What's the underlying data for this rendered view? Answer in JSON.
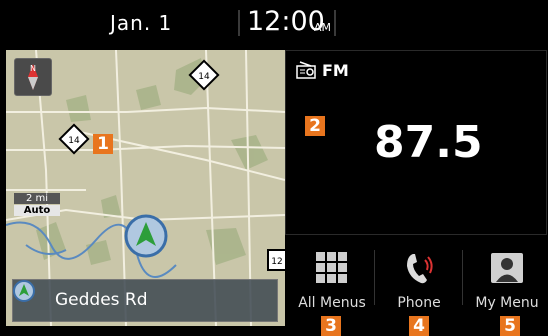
{
  "status_bar": {
    "date": "Jan.  1",
    "time": "12:00",
    "ampm": "AM"
  },
  "map": {
    "compass_letter": "N",
    "scale_distance": "2 mi",
    "scale_mode": "Auto",
    "street_name": "Geddes Rd",
    "route_shields": [
      "14",
      "14",
      "12"
    ]
  },
  "radio": {
    "band": "FM",
    "frequency": "87.5"
  },
  "menus": [
    {
      "label": "All Menus",
      "icon": "grid-icon"
    },
    {
      "label": "Phone",
      "icon": "phone-icon"
    },
    {
      "label": "My Menu",
      "icon": "person-icon"
    }
  ],
  "callouts": [
    "1",
    "2",
    "3",
    "4",
    "5"
  ],
  "colors": {
    "callout": "#e8751e",
    "map_base": "#c9c6a9",
    "nav_arrow": "#2d9e3a"
  }
}
